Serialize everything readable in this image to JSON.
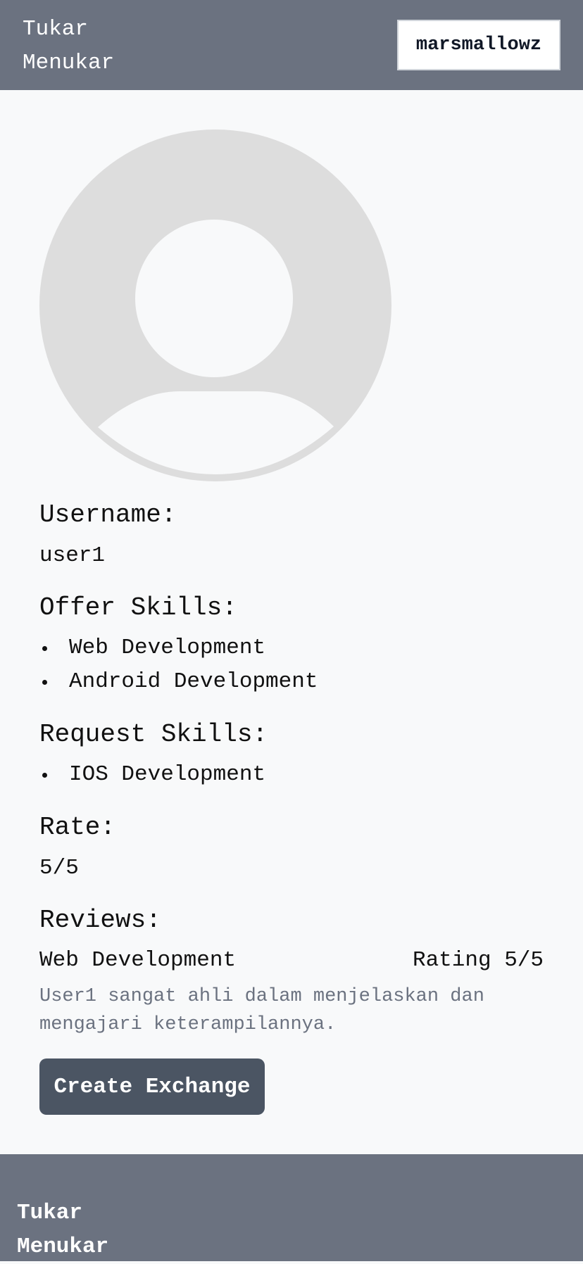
{
  "header": {
    "brand": "Tukar Menukar",
    "username_button": "marsmallowz"
  },
  "profile": {
    "avatar_icon": "user-avatar-icon",
    "username_label": "Username:",
    "username_value": "user1",
    "offer_label": "Offer Skills:",
    "offer_skills": [
      "Web Development",
      "Android Development"
    ],
    "request_label": "Request Skills:",
    "request_skills": [
      "IOS Development"
    ],
    "rate_label": "Rate:",
    "rate_value": "5/5",
    "reviews_label": "Reviews:",
    "reviews": [
      {
        "skill": "Web Development",
        "rating": "Rating 5/5",
        "text": "User1 sangat ahli dalam menjelaskan dan mengajari keterampilannya."
      }
    ],
    "create_button": "Create Exchange"
  },
  "footer": {
    "brand": "Tukar Menukar"
  },
  "colors": {
    "header_bg": "#6b7280",
    "page_bg": "#f8f9fa",
    "button_bg": "#4b5563",
    "avatar": "#dddddd",
    "muted_text": "#6b7280"
  }
}
